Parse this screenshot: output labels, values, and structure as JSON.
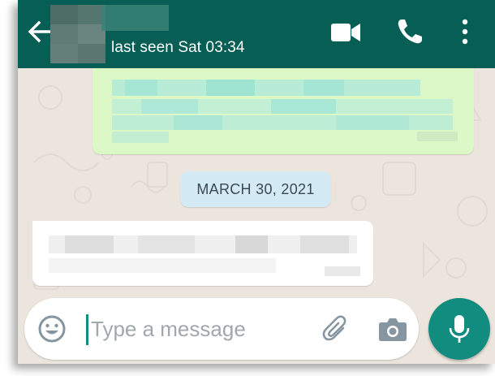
{
  "header": {
    "back_icon": "arrow-left-icon",
    "contact_name": "",
    "status": "last seen Sat 03:34",
    "actions": [
      {
        "icon": "video-call-icon"
      },
      {
        "icon": "voice-call-icon"
      },
      {
        "icon": "more-vertical-icon"
      }
    ],
    "color": "#075e54"
  },
  "conversation": {
    "date_separator": "MARCH 30, 2021",
    "messages": [
      {
        "direction": "outgoing",
        "text": "",
        "bubble_color": "#dcf8c6"
      },
      {
        "direction": "incoming",
        "text": "",
        "bubble_color": "#ffffff"
      }
    ]
  },
  "composer": {
    "placeholder": "Type a message",
    "value": "",
    "icons": [
      "emoji-icon",
      "paperclip-icon",
      "camera-icon"
    ],
    "send_icon": "microphone-icon",
    "accent": "#128c7e"
  }
}
